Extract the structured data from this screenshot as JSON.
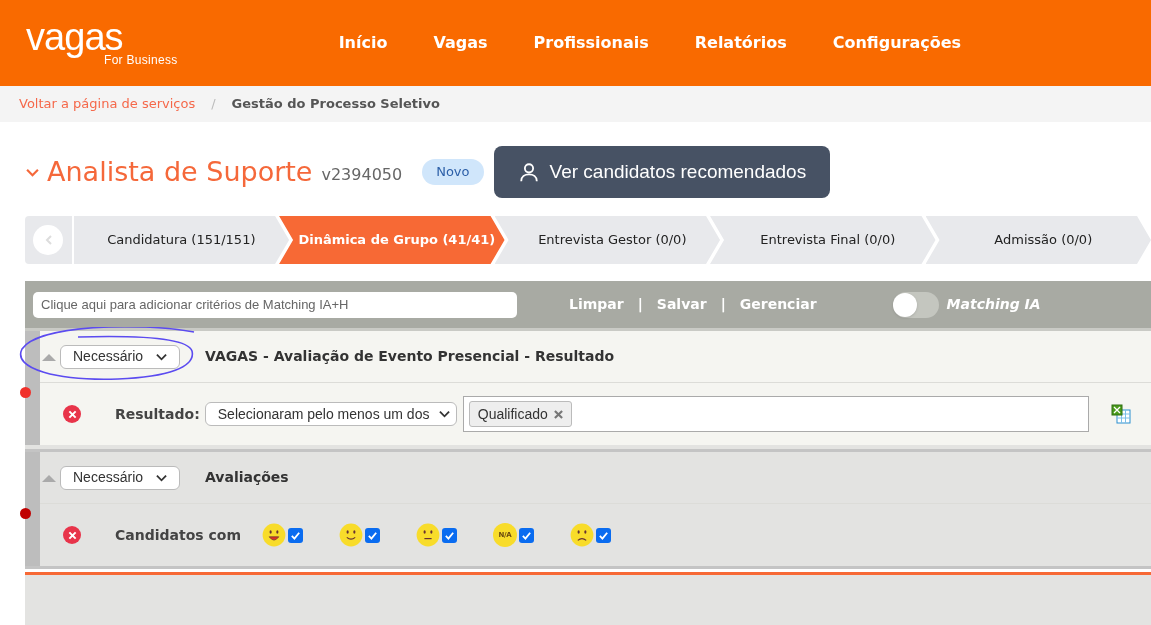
{
  "header": {
    "logo": "vagas",
    "logo_sub": "For Business",
    "nav": [
      "Início",
      "Vagas",
      "Profissionais",
      "Relatórios",
      "Configurações"
    ]
  },
  "breadcrumb": {
    "separator": "/",
    "items": [
      {
        "label": "Voltar a página de serviços",
        "kind": "link"
      },
      {
        "label": "Gestão do Processo Seletivo",
        "kind": "current"
      }
    ]
  },
  "job": {
    "title": "Analista de Suporte",
    "code": "v2394050",
    "badge": "Novo",
    "button": "Ver candidatos recomendados"
  },
  "steps": [
    {
      "label": "Candidatura (151/151)",
      "selected": false
    },
    {
      "label": "Dinâmica de Grupo (41/41)",
      "selected": true
    },
    {
      "label": "Entrevista Gestor (0/0)",
      "selected": false
    },
    {
      "label": "Entrevista Final (0/0)",
      "selected": false
    },
    {
      "label": "Admissão (0/0)",
      "selected": false
    }
  ],
  "filter": {
    "placeholder": "Clique aqui para adicionar critérios de Matching IA+H",
    "separator": "|",
    "actions": [
      "Limpar",
      "Salvar",
      "Gerenciar"
    ],
    "toggle": {
      "label": "Matching IA",
      "on": false
    }
  },
  "sections": [
    {
      "requirement": "Necessário",
      "title": "VAGAS - Avaliação de Evento Presencial - Resultado",
      "color": "#f0302a",
      "circled": true,
      "criterion": {
        "kind": "tags",
        "label": "Resultado:",
        "operator": "Selecionaram pelo menos um dos",
        "tags": [
          "Qualificado"
        ]
      }
    },
    {
      "requirement": "Necessário",
      "title": "Avaliações",
      "color": "#c00000",
      "circled": false,
      "criterion": {
        "kind": "ratings",
        "label": "Candidatos com",
        "ratings": [
          {
            "kind": "grin",
            "checked": true
          },
          {
            "kind": "smile",
            "checked": true
          },
          {
            "kind": "neutral",
            "checked": true
          },
          {
            "kind": "na",
            "text": "N/A",
            "checked": true
          },
          {
            "kind": "sad",
            "checked": true
          }
        ]
      }
    }
  ]
}
